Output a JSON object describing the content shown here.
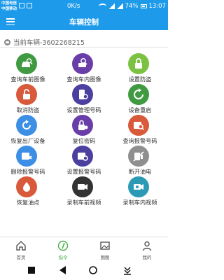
{
  "status_bar": {
    "carrier_1": "中国电信",
    "carrier_2": "中国移动",
    "net_speed": "0K/s",
    "battery": "74%",
    "time": "13:07"
  },
  "header": {
    "title": "车辆控制",
    "accent_color": "#1d9bea"
  },
  "vehicle": {
    "label": "当前车辆-3602268215"
  },
  "commands": [
    {
      "label": "查询车前图像",
      "icon": "car-front-camera-icon",
      "color": "#3f9a41"
    },
    {
      "label": "查询车内图像",
      "icon": "car-interior-camera-icon",
      "color": "#6a3ea8"
    },
    {
      "label": "设置防盗",
      "icon": "lock-icon",
      "color": "#7cc242"
    },
    {
      "label": "取消防盗",
      "icon": "unlock-icon",
      "color": "#d85a3b"
    },
    {
      "label": "设置管理号码",
      "icon": "phone-settings-icon",
      "color": "#4b3fa0"
    },
    {
      "label": "设备重启",
      "icon": "restart-icon",
      "color": "#3f9a41"
    },
    {
      "label": "恢复出厂设备",
      "icon": "factory-reset-icon",
      "color": "#3d8fe6"
    },
    {
      "label": "复位密码",
      "icon": "reset-password-icon",
      "color": "#6a3ea8"
    },
    {
      "label": "查询报警号码",
      "icon": "alarm-query-icon",
      "color": "#d85a3b"
    },
    {
      "label": "删除报警号码",
      "icon": "alarm-delete-icon",
      "color": "#3d8fe6"
    },
    {
      "label": "设置报警号码",
      "icon": "alarm-settings-icon",
      "color": "#4b3fa0"
    },
    {
      "label": "断开油电",
      "icon": "fuel-cut-icon",
      "color": "#8f8f8f"
    },
    {
      "label": "恢复油点",
      "icon": "fuel-restore-icon",
      "color": "#d85a3b"
    },
    {
      "label": "录制车前视频",
      "icon": "record-front-video-icon",
      "color": "#333333"
    },
    {
      "label": "录制车内视频",
      "icon": "record-interior-video-icon",
      "color": "#2b9bb5"
    }
  ],
  "bottom_nav": [
    {
      "label": "首页",
      "icon": "home-icon"
    },
    {
      "label": "指令",
      "icon": "command-icon",
      "active": true
    },
    {
      "label": "图图",
      "icon": "gallery-icon"
    },
    {
      "label": "我的",
      "icon": "profile-icon"
    }
  ]
}
